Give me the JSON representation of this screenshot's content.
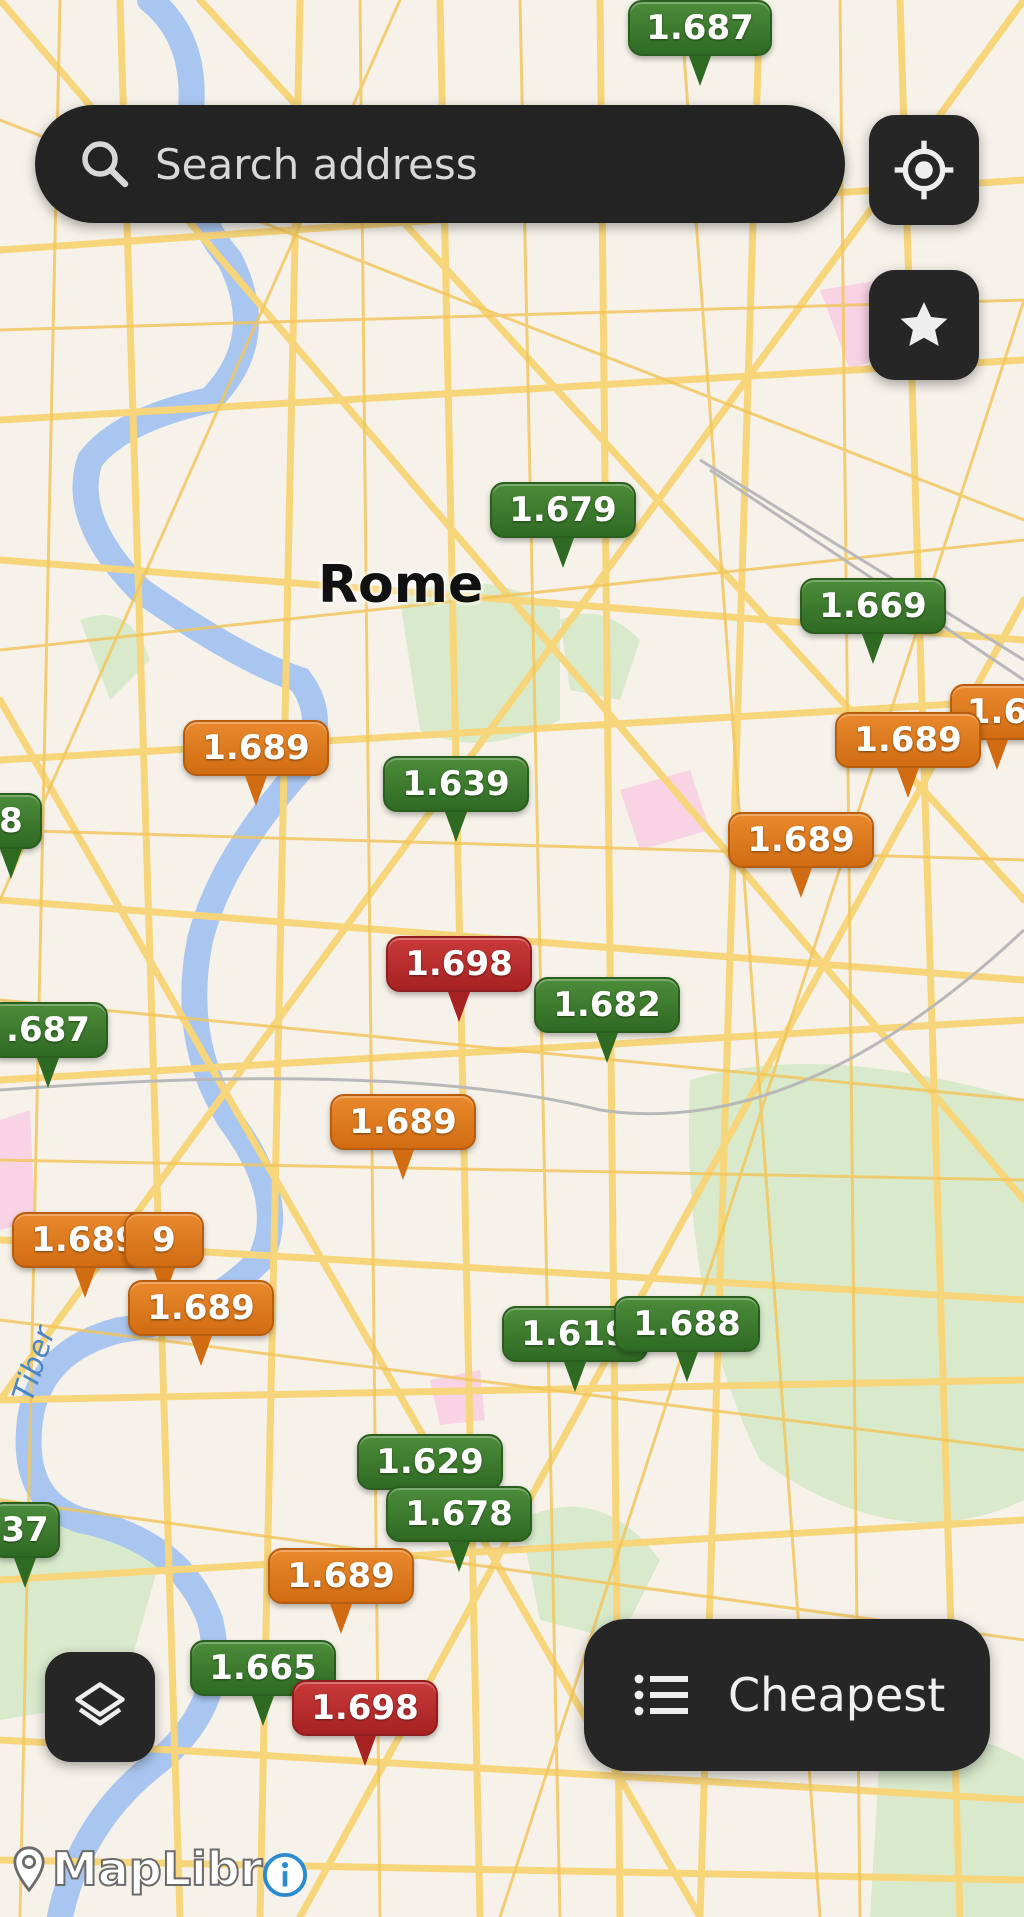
{
  "search": {
    "placeholder": "Search address",
    "icon": "search-icon"
  },
  "buttons": {
    "locate": {
      "icon": "crosshair-icon"
    },
    "favorites": {
      "icon": "star-icon"
    },
    "layers": {
      "icon": "layers-icon"
    },
    "cheapest": {
      "label": "Cheapest",
      "icon": "list-icon"
    }
  },
  "map": {
    "city_label": "Rome",
    "river_label": "Tiber",
    "attribution": "MapLibre",
    "colors": {
      "green": "#2f6a23",
      "orange": "#d16c13",
      "red": "#a72222",
      "roads": "#f7d57a",
      "water": "#a9c6f0",
      "park": "#cfe6c4"
    }
  },
  "prices": [
    {
      "value": "1.687",
      "level": "green"
    },
    {
      "value": "1.679",
      "level": "green"
    },
    {
      "value": "1.669",
      "level": "green"
    },
    {
      "value": "1.6",
      "level": "orange"
    },
    {
      "value": "1.689",
      "level": "orange"
    },
    {
      "value": "1.689",
      "level": "orange"
    },
    {
      "value": "1.639",
      "level": "green"
    },
    {
      "value": "8",
      "level": "green"
    },
    {
      "value": "1.689",
      "level": "orange"
    },
    {
      "value": "1.698",
      "level": "red"
    },
    {
      "value": "1.682",
      "level": "green"
    },
    {
      "value": ".687",
      "level": "green"
    },
    {
      "value": "1.689",
      "level": "orange"
    },
    {
      "value": "9",
      "level": "orange"
    },
    {
      "value": "1.689",
      "level": "orange"
    },
    {
      "value": "1.689",
      "level": "orange"
    },
    {
      "value": "1.619",
      "level": "green"
    },
    {
      "value": "1.688",
      "level": "green"
    },
    {
      "value": "1.629",
      "level": "green"
    },
    {
      "value": "1.678",
      "level": "green"
    },
    {
      "value": "37",
      "level": "green"
    },
    {
      "value": "1.689",
      "level": "orange"
    },
    {
      "value": "1.665",
      "level": "green"
    },
    {
      "value": "1.698",
      "level": "red"
    }
  ]
}
